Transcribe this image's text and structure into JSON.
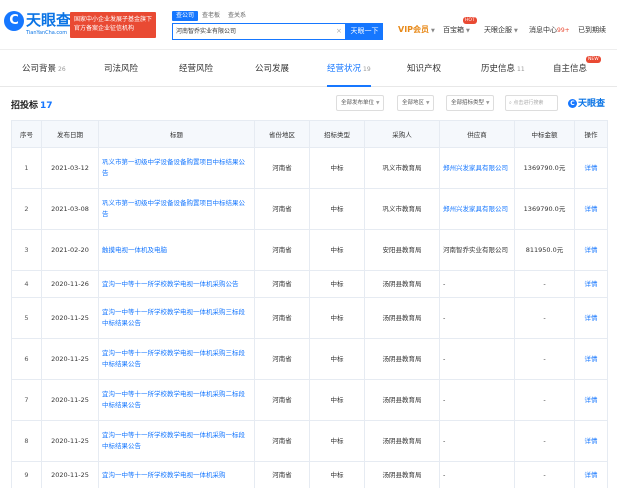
{
  "header": {
    "logo_text": "天眼查",
    "logo_sub": "TianYanCha.com",
    "promo": "国家中小企业发展子基金旗下官方备案企业征信机构",
    "search_tabs": [
      "查公司",
      "查老板",
      "查关系"
    ],
    "search_value": "河南智乔实业有限公司",
    "search_clear": "×",
    "search_button": "天眼一下",
    "vip": "VIP会员",
    "hot_badge": "HOT",
    "nav_baibao": "百宝箱",
    "nav_qiye": "天眼企服",
    "nav_msg": "消息中心",
    "msg_count": "99+",
    "nav_user": "已到期续"
  },
  "tabs": [
    {
      "label": "公司背景",
      "count": "26"
    },
    {
      "label": "司法风险",
      "count": ""
    },
    {
      "label": "经营风险",
      "count": ""
    },
    {
      "label": "公司发展",
      "count": ""
    },
    {
      "label": "经营状况",
      "count": "19"
    },
    {
      "label": "知识产权",
      "count": ""
    },
    {
      "label": "历史信息",
      "count": "11"
    },
    {
      "label": "自主信息",
      "count": ""
    }
  ],
  "tab_badge": "NEW",
  "section": {
    "title": "招投标",
    "count": "17",
    "filter_units": "全部发布单位",
    "filter_region": "全部地区",
    "filter_types": "全部招标类型",
    "search_placeholder": "点击进行搜索",
    "brand": "天眼查"
  },
  "table": {
    "headers": [
      "序号",
      "发布日期",
      "标题",
      "省份地区",
      "招标类型",
      "采购人",
      "供应商",
      "中标金额",
      "操作"
    ],
    "rows": [
      {
        "idx": "1",
        "date": "2021-03-12",
        "title": "巩义市第一初级中学设备设备购置项目中标结果公告",
        "region": "河南省",
        "type": "中标",
        "buyer": "巩义市教育局",
        "supplier": "郑州兴发家具有限公司",
        "supplier_link": true,
        "amount": "1369790.0元",
        "op": "详情"
      },
      {
        "idx": "2",
        "date": "2021-03-08",
        "title": "巩义市第一初级中学设备设备购置项目中标结果公告",
        "region": "河南省",
        "type": "中标",
        "buyer": "巩义市教育局",
        "supplier": "郑州兴发家具有限公司",
        "supplier_link": true,
        "amount": "1369790.0元",
        "op": "详情"
      },
      {
        "idx": "3",
        "date": "2021-02-20",
        "title": "触摸电视一体机及电脑",
        "region": "河南省",
        "type": "中标",
        "buyer": "安阳县教育局",
        "supplier": "河南智乔实业有限公司",
        "supplier_link": false,
        "amount": "811950.0元",
        "op": "详情"
      },
      {
        "idx": "4",
        "date": "2020-11-26",
        "title": "宜沟一中等十一所学校教学电视一体机采购公告",
        "region": "河南省",
        "type": "中标",
        "buyer": "汤阴县教育局",
        "supplier": "-",
        "supplier_link": false,
        "amount": "-",
        "op": "详情"
      },
      {
        "idx": "5",
        "date": "2020-11-25",
        "title": "宜沟一中等十一所学校教学电视一体机采购三标段中标结果公告",
        "region": "河南省",
        "type": "中标",
        "buyer": "汤阴县教育局",
        "supplier": "-",
        "supplier_link": false,
        "amount": "-",
        "op": "详情"
      },
      {
        "idx": "6",
        "date": "2020-11-25",
        "title": "宜沟一中等十一所学校教学电视一体机采购三标段中标结果公告",
        "region": "河南省",
        "type": "中标",
        "buyer": "汤阴县教育局",
        "supplier": "-",
        "supplier_link": false,
        "amount": "-",
        "op": "详情"
      },
      {
        "idx": "7",
        "date": "2020-11-25",
        "title": "宜沟一中等十一所学校教学电视一体机采购二标段中标结果公告",
        "region": "河南省",
        "type": "中标",
        "buyer": "汤阴县教育局",
        "supplier": "-",
        "supplier_link": false,
        "amount": "-",
        "op": "详情"
      },
      {
        "idx": "8",
        "date": "2020-11-25",
        "title": "宜沟一中等十一所学校教学电视一体机采购一标段中标结果公告",
        "region": "河南省",
        "type": "中标",
        "buyer": "汤阴县教育局",
        "supplier": "-",
        "supplier_link": false,
        "amount": "-",
        "op": "详情"
      },
      {
        "idx": "9",
        "date": "2020-11-25",
        "title": "宜沟一中等十一所学校教学电视一体机采购",
        "region": "河南省",
        "type": "中标",
        "buyer": "汤阴县教育局",
        "supplier": "-",
        "supplier_link": false,
        "amount": "-",
        "op": "详情"
      }
    ]
  },
  "colors": {
    "accent": "#1677ff",
    "promo": "#e94a33",
    "vip": "#e88a1a"
  }
}
